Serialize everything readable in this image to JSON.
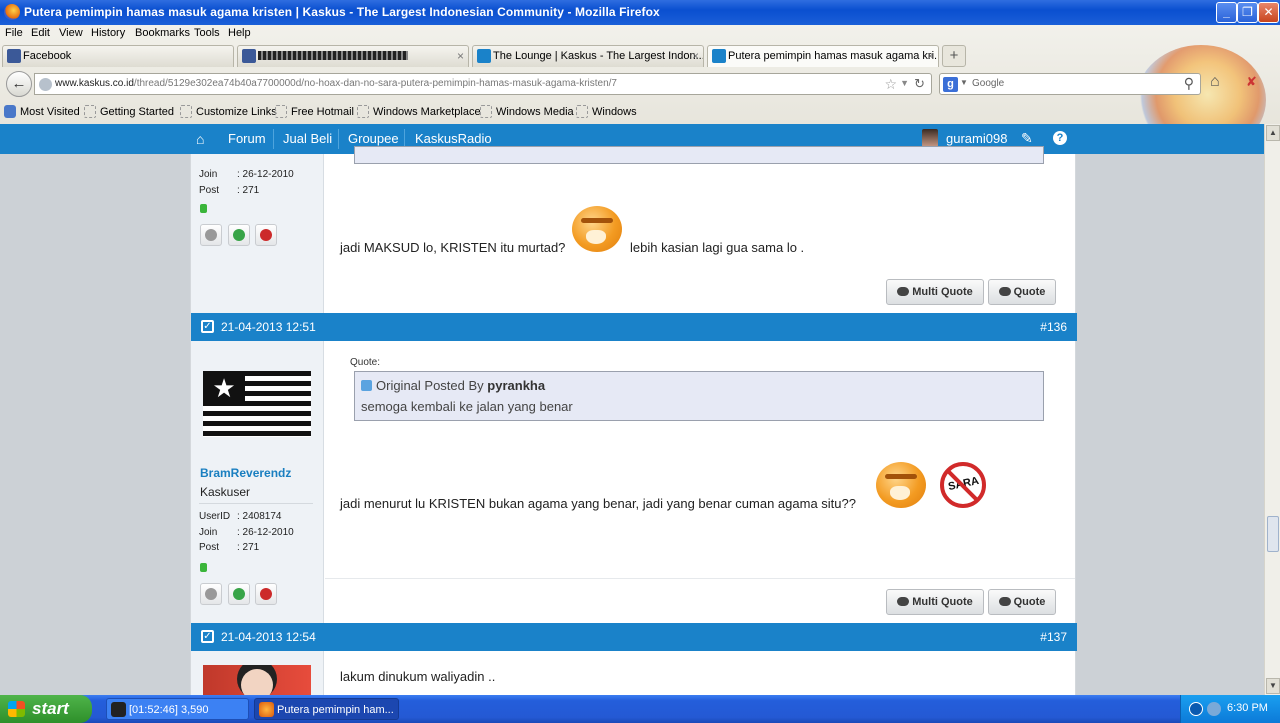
{
  "window": {
    "title": "Putera pemimpin hamas masuk agama kristen | Kaskus - The Largest Indonesian Community - Mozilla Firefox",
    "min_label": "_",
    "max_label": "❐",
    "close_label": "✕"
  },
  "menu": [
    "File",
    "Edit",
    "View",
    "History",
    "Bookmarks",
    "Tools",
    "Help"
  ],
  "tabs": [
    {
      "label": "Facebook",
      "icon": "facebook-icon",
      "color": "#3b5998"
    },
    {
      "label": "",
      "icon": "facebook-icon",
      "color": "#3b5998"
    },
    {
      "label": "The Lounge | Kaskus - The Largest Indon...",
      "icon": "kaskus-icon",
      "color": "#1a82c9"
    },
    {
      "label": "Putera pemimpin hamas masuk agama kri...",
      "icon": "kaskus-icon",
      "color": "#1a82c9"
    }
  ],
  "new_tab_label": "+",
  "tab_close": "×",
  "address": {
    "domain": "www.kaskus.co.id",
    "path": "/thread/5129e302ea74b40a7700000d/no-hoax-dan-no-sara-putera-pemimpin-hamas-masuk-agama-kristen/7"
  },
  "search": {
    "engine": "g",
    "placeholder": "Google"
  },
  "bookmarks": [
    "Most Visited",
    "Getting Started",
    "Customize Links",
    "Free Hotmail",
    "Windows Marketplace",
    "Windows Media",
    "Windows"
  ],
  "kaskus_nav": {
    "items": [
      "Forum",
      "Jual Beli",
      "Groupee",
      "KaskusRadio"
    ],
    "username": "gurami098",
    "accent": "#1a82c9"
  },
  "post_top": {
    "join_label": "Join",
    "join_value": ": 26-12-2010",
    "post_label": "Post",
    "post_value": ": 271",
    "message_before": "jadi MAKSUD lo, KRISTEN itu murtad?",
    "message_after": "lebih kasian lagi gua sama lo ."
  },
  "buttons": {
    "multi_quote": "Multi Quote",
    "quote": "Quote"
  },
  "post_136": {
    "date": "21-04-2013 12:51",
    "number": "#136",
    "username": "BramReverendz",
    "rank": "Kaskuser",
    "userid_label": "UserID",
    "userid_value": ": 2408174",
    "join_label": "Join",
    "join_value": ": 26-12-2010",
    "post_label": "Post",
    "post_value": ": 271",
    "quote_label": "Quote:",
    "quote_head_prefix": "Original Posted By",
    "quote_author": "pyrankha",
    "quote_text": "semoga kembali ke jalan yang benar",
    "message": "jadi menurut lu KRISTEN bukan agama yang benar, jadi yang benar cuman agama situ??",
    "sara_label": "SARA"
  },
  "post_137": {
    "date": "21-04-2013 12:54",
    "number": "#137",
    "message": "lakum dinukum waliyadin .."
  },
  "taskbar": {
    "start_label": "start",
    "tasks": [
      "[01:52:46] 3,590",
      "Putera pemimpin ham..."
    ],
    "clock": "6:30 PM"
  }
}
